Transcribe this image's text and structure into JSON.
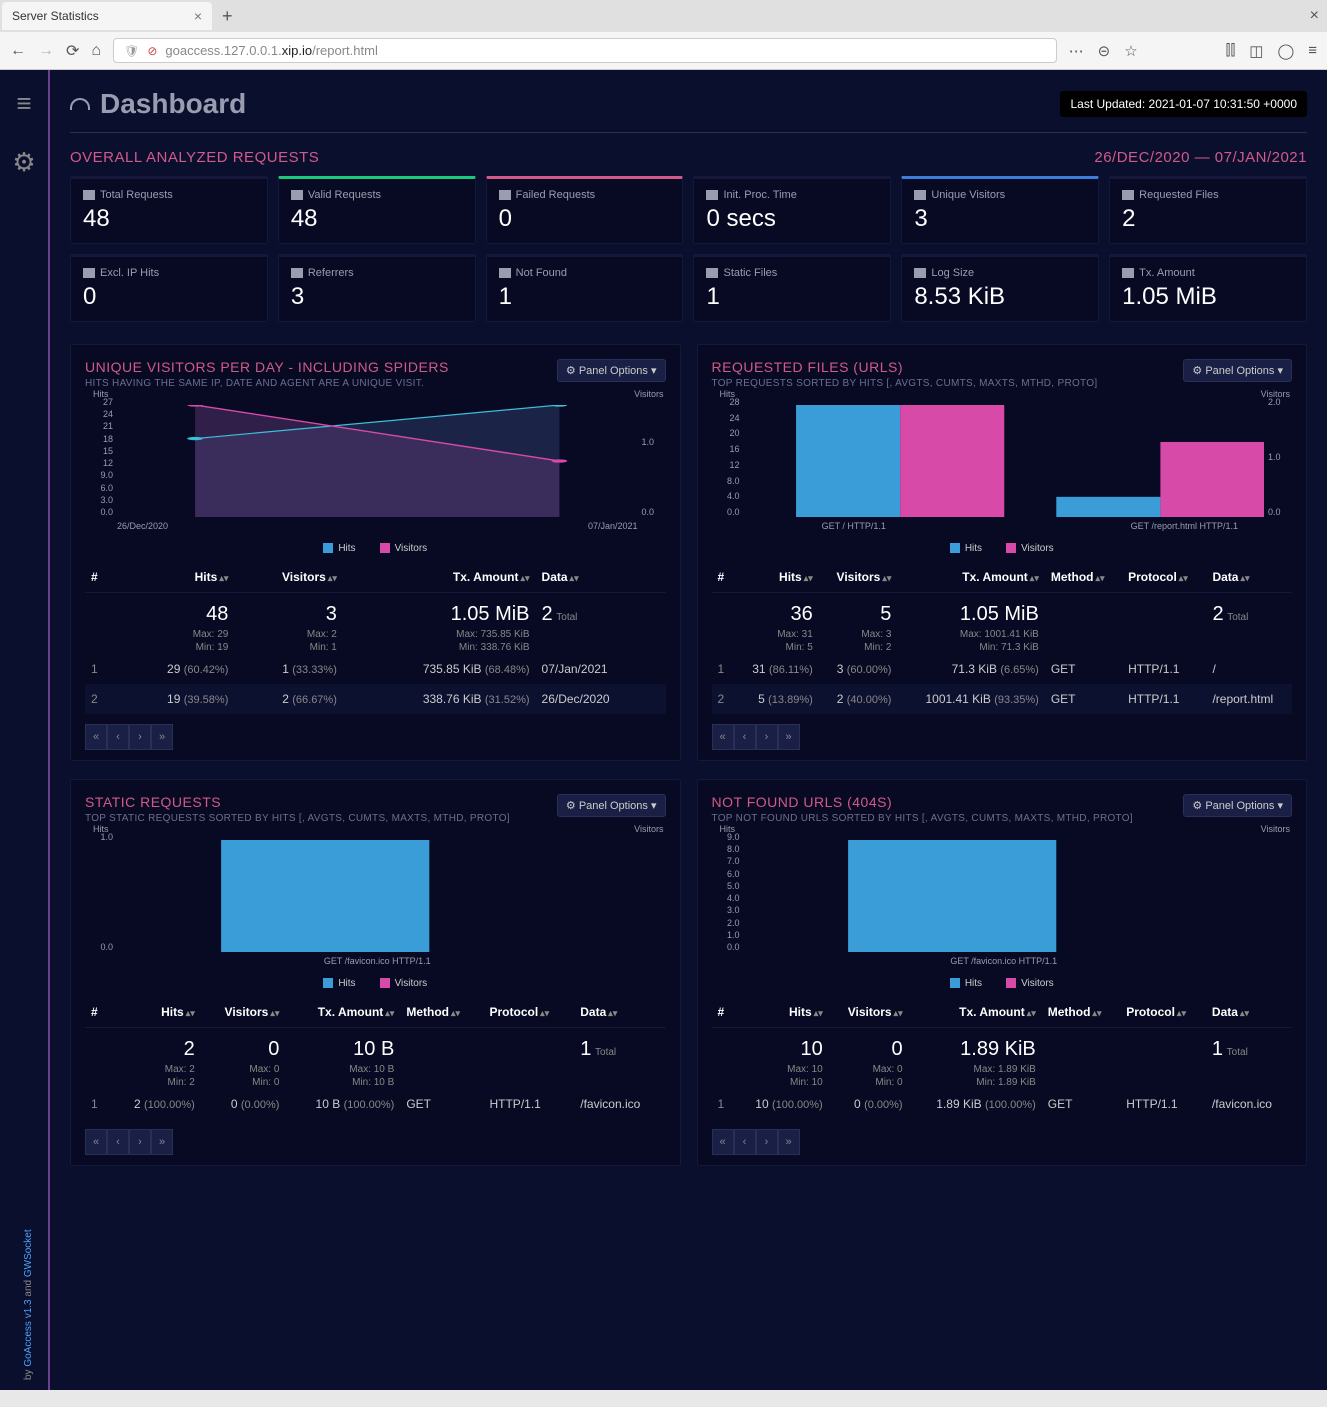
{
  "browser": {
    "tab_title": "Server Statistics",
    "url_pre": "goaccess.127.0.0.1.",
    "url_bold": "xip.io",
    "url_post": "/report.html"
  },
  "header": {
    "title": "Dashboard",
    "last_updated": "Last Updated: 2021-01-07 10:31:50 +0000"
  },
  "overall": {
    "title": "OVERALL ANALYZED REQUESTS",
    "date_range": "26/DEC/2020 — 07/JAN/2021",
    "stats": {
      "total_requests": {
        "label": "Total Requests",
        "value": "48"
      },
      "valid_requests": {
        "label": "Valid Requests",
        "value": "48"
      },
      "failed_requests": {
        "label": "Failed Requests",
        "value": "0"
      },
      "init_proc_time": {
        "label": "Init. Proc. Time",
        "value": "0 secs"
      },
      "unique_visitors": {
        "label": "Unique Visitors",
        "value": "3"
      },
      "requested_files": {
        "label": "Requested Files",
        "value": "2"
      },
      "excl_ip_hits": {
        "label": "Excl. IP Hits",
        "value": "0"
      },
      "referrers": {
        "label": "Referrers",
        "value": "3"
      },
      "not_found": {
        "label": "Not Found",
        "value": "1"
      },
      "static_files": {
        "label": "Static Files",
        "value": "1"
      },
      "log_size": {
        "label": "Log Size",
        "value": "8.53 KiB"
      },
      "tx_amount": {
        "label": "Tx. Amount",
        "value": "1.05 MiB"
      }
    }
  },
  "panel_options_label": "Panel Options",
  "legend": {
    "hits": "Hits",
    "visitors": "Visitors"
  },
  "cols": {
    "idx": "#",
    "hits": "Hits",
    "visitors": "Visitors",
    "tx": "Tx. Amount",
    "data": "Data",
    "method": "Method",
    "protocol": "Protocol"
  },
  "total_label": "Total",
  "visitors_panel": {
    "title": "UNIQUE VISITORS PER DAY - INCLUDING SPIDERS",
    "sub": "HITS HAVING THE SAME IP, DATE AND AGENT ARE A UNIQUE VISIT.",
    "summary": {
      "hits": "48",
      "visitors": "3",
      "tx": "1.05 MiB",
      "data": "2",
      "max_hits": "Max: 29",
      "min_hits": "Min: 19",
      "max_vis": "Max: 2",
      "min_vis": "Min: 1",
      "max_tx": "Max: 735.85 KiB",
      "min_tx": "Min: 338.76 KiB"
    },
    "rows": [
      {
        "i": "1",
        "hits": "29",
        "hits_pct": "(60.42%)",
        "vis": "1",
        "vis_pct": "(33.33%)",
        "tx": "735.85 KiB",
        "tx_pct": "(68.48%)",
        "data": "07/Jan/2021"
      },
      {
        "i": "2",
        "hits": "19",
        "hits_pct": "(39.58%)",
        "vis": "2",
        "vis_pct": "(66.67%)",
        "tx": "338.76 KiB",
        "tx_pct": "(31.52%)",
        "data": "26/Dec/2020"
      }
    ]
  },
  "files_panel": {
    "title": "REQUESTED FILES (URLS)",
    "sub": "TOP REQUESTS SORTED BY HITS [, AVGTS, CUMTS, MAXTS, MTHD, PROTO]",
    "summary": {
      "hits": "36",
      "visitors": "5",
      "tx": "1.05 MiB",
      "data": "2",
      "max_hits": "Max: 31",
      "min_hits": "Min: 5",
      "max_vis": "Max: 3",
      "min_vis": "Min: 2",
      "max_tx": "Max: 1001.41 KiB",
      "min_tx": "Min: 71.3 KiB"
    },
    "rows": [
      {
        "i": "1",
        "hits": "31",
        "hits_pct": "(86.11%)",
        "vis": "3",
        "vis_pct": "(60.00%)",
        "tx": "71.3 KiB",
        "tx_pct": "(6.65%)",
        "method": "GET",
        "proto": "HTTP/1.1",
        "data": "/"
      },
      {
        "i": "2",
        "hits": "5",
        "hits_pct": "(13.89%)",
        "vis": "2",
        "vis_pct": "(40.00%)",
        "tx": "1001.41 KiB",
        "tx_pct": "(93.35%)",
        "method": "GET",
        "proto": "HTTP/1.1",
        "data": "/report.html"
      }
    ],
    "xticks": [
      "GET / HTTP/1.1",
      "GET /report.html HTTP/1.1"
    ]
  },
  "static_panel": {
    "title": "STATIC REQUESTS",
    "sub": "TOP STATIC REQUESTS SORTED BY HITS [, AVGTS, CUMTS, MAXTS, MTHD, PROTO]",
    "summary": {
      "hits": "2",
      "visitors": "0",
      "tx": "10 B",
      "data": "1",
      "max_hits": "Max: 2",
      "min_hits": "Min: 2",
      "max_vis": "Max: 0",
      "min_vis": "Min: 0",
      "max_tx": "Max: 10 B",
      "min_tx": "Min: 10 B"
    },
    "rows": [
      {
        "i": "1",
        "hits": "2",
        "hits_pct": "(100.00%)",
        "vis": "0",
        "vis_pct": "(0.00%)",
        "tx": "10 B",
        "tx_pct": "(100.00%)",
        "method": "GET",
        "proto": "HTTP/1.1",
        "data": "/favicon.ico"
      }
    ],
    "xtick": "GET /favicon.ico HTTP/1.1"
  },
  "notfound_panel": {
    "title": "NOT FOUND URLS (404S)",
    "sub": "TOP NOT FOUND URLS SORTED BY HITS [, AVGTS, CUMTS, MAXTS, MTHD, PROTO]",
    "summary": {
      "hits": "10",
      "visitors": "0",
      "tx": "1.89 KiB",
      "data": "1",
      "max_hits": "Max: 10",
      "min_hits": "Min: 10",
      "max_vis": "Max: 0",
      "min_vis": "Min: 0",
      "max_tx": "Max: 1.89 KiB",
      "min_tx": "Min: 1.89 KiB"
    },
    "rows": [
      {
        "i": "1",
        "hits": "10",
        "hits_pct": "(100.00%)",
        "vis": "0",
        "vis_pct": "(0.00%)",
        "tx": "1.89 KiB",
        "tx_pct": "(100.00%)",
        "method": "GET",
        "proto": "HTTP/1.1",
        "data": "/favicon.ico"
      }
    ],
    "xtick": "GET /favicon.ico HTTP/1.1"
  },
  "credits": {
    "by": "by",
    "lnk1": "GoAccess",
    "v": "v1.3",
    "and": "and",
    "lnk2": "GWSocket"
  },
  "chart_data": [
    {
      "type": "line",
      "panel": "visitors",
      "x": [
        "26/Dec/2020",
        "07/Jan/2021"
      ],
      "series": [
        {
          "name": "Hits",
          "values": [
            19,
            29
          ],
          "axis": "left"
        },
        {
          "name": "Visitors",
          "values": [
            2,
            1
          ],
          "axis": "right"
        }
      ],
      "ylim_left": [
        0,
        27
      ],
      "yticks_left": [
        0,
        3,
        6,
        9,
        12,
        15,
        18,
        21,
        24,
        27
      ],
      "ylim_right": [
        0,
        1
      ],
      "yticks_right": [
        0,
        1
      ],
      "ylabel_left": "Hits",
      "ylabel_right": "Visitors"
    },
    {
      "type": "bar",
      "panel": "files",
      "categories": [
        "GET / HTTP/1.1",
        "GET /report.html HTTP/1.1"
      ],
      "series": [
        {
          "name": "Hits",
          "values": [
            31,
            5
          ],
          "axis": "left"
        },
        {
          "name": "Visitors",
          "values": [
            3,
            2
          ],
          "axis": "right"
        }
      ],
      "ylim_left": [
        0,
        28
      ],
      "yticks_left": [
        0,
        4,
        8,
        12,
        16,
        20,
        24,
        28
      ],
      "ylim_right": [
        0,
        2
      ],
      "yticks_right": [
        0,
        1,
        2
      ],
      "ylabel_left": "Hits",
      "ylabel_right": "Visitors"
    },
    {
      "type": "bar",
      "panel": "static",
      "categories": [
        "GET /favicon.ico HTTP/1.1"
      ],
      "series": [
        {
          "name": "Hits",
          "values": [
            2
          ],
          "axis": "left"
        },
        {
          "name": "Visitors",
          "values": [
            0
          ],
          "axis": "right"
        }
      ],
      "ylim_left": [
        0,
        1
      ],
      "yticks_left": [
        0,
        1
      ],
      "ylabel_left": "Hits",
      "ylabel_right": "Visitors"
    },
    {
      "type": "bar",
      "panel": "notfound",
      "categories": [
        "GET /favicon.ico HTTP/1.1"
      ],
      "series": [
        {
          "name": "Hits",
          "values": [
            10
          ],
          "axis": "left"
        },
        {
          "name": "Visitors",
          "values": [
            0
          ],
          "axis": "right"
        }
      ],
      "ylim_left": [
        0,
        9
      ],
      "yticks_left": [
        0,
        1,
        2,
        3,
        4,
        5,
        6,
        7,
        8,
        9
      ],
      "ylabel_left": "Hits",
      "ylabel_right": "Visitors"
    }
  ]
}
